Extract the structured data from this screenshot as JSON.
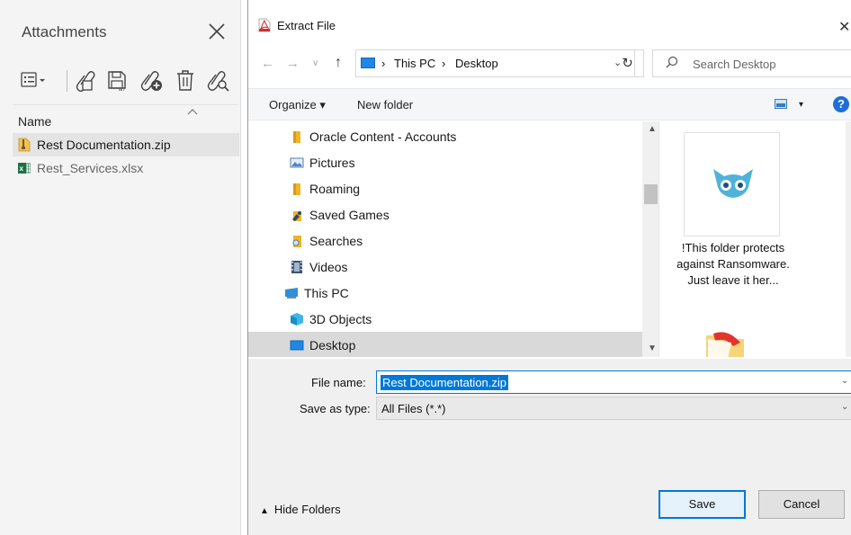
{
  "attachments": {
    "title": "Attachments",
    "column_name": "Name",
    "toolbar_icons": [
      "options-icon",
      "open-attachment-icon",
      "save-attachment-icon",
      "add-attachment-icon",
      "delete-icon",
      "search-attachment-icon"
    ],
    "items": [
      {
        "name": "Rest Documentation.zip",
        "icon": "zip-icon",
        "selected": true
      },
      {
        "name": "Rest_Services.xlsx",
        "icon": "excel-icon",
        "selected": false
      }
    ]
  },
  "dialog": {
    "title": "Extract File",
    "breadcrumb": [
      "This PC",
      "Desktop"
    ],
    "search_placeholder": "Search Desktop",
    "organize_label": "Organize ▾",
    "new_folder_label": "New folder",
    "help_glyph": "?",
    "tree": [
      {
        "label": "Oracle Content - Accounts",
        "icon": "folder-icon",
        "indent": 1
      },
      {
        "label": "Pictures",
        "icon": "pictures-icon",
        "indent": 1
      },
      {
        "label": "Roaming",
        "icon": "folder-icon",
        "indent": 1
      },
      {
        "label": "Saved Games",
        "icon": "saved-games-icon",
        "indent": 1
      },
      {
        "label": "Searches",
        "icon": "searches-icon",
        "indent": 1
      },
      {
        "label": "Videos",
        "icon": "videos-icon",
        "indent": 1
      },
      {
        "label": "This PC",
        "icon": "computer-icon",
        "indent": 0
      },
      {
        "label": "3D Objects",
        "icon": "3d-objects-icon",
        "indent": 1
      },
      {
        "label": "Desktop",
        "icon": "desktop-icon",
        "indent": 1,
        "selected": true
      }
    ],
    "preview_text": "!This folder protects against Ransomware. Just leave it her...",
    "file_name_label": "File name:",
    "file_name_value": "Rest Documentation.zip",
    "save_type_label": "Save as type:",
    "save_type_value": "All Files (*.*)",
    "hide_folders_label": "Hide Folders",
    "save_label": "Save",
    "cancel_label": "Cancel",
    "accent_color": "#0078d7"
  }
}
